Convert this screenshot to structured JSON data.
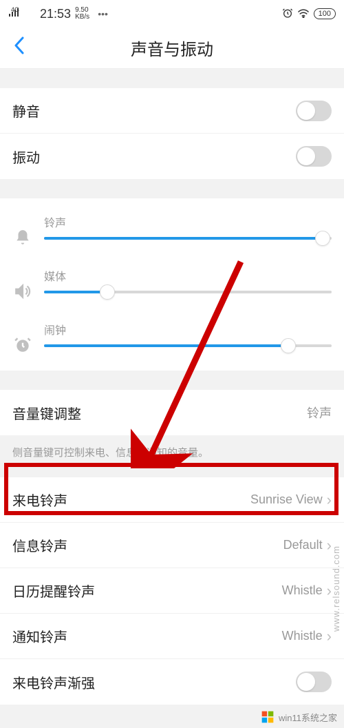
{
  "status": {
    "signal": "4G",
    "time": "21:53",
    "speed_top": "9.50",
    "speed_bottom": "KB/s",
    "dots": "•••",
    "battery": "100"
  },
  "header": {
    "title": "声音与振动"
  },
  "toggles": {
    "silent": "静音",
    "vibrate": "振动"
  },
  "sliders": {
    "ringtone": "铃声",
    "media": "媒体",
    "alarm": "闹钟",
    "ringtone_pct": 97,
    "media_pct": 22,
    "alarm_pct": 85
  },
  "volume_key": {
    "label": "音量键调整",
    "value": "铃声",
    "helper": "侧音量键可控制来电、信息和通知的音量。"
  },
  "ringtones": {
    "call": {
      "label": "来电铃声",
      "value": "Sunrise View"
    },
    "message": {
      "label": "信息铃声",
      "value": "Default"
    },
    "calendar": {
      "label": "日历提醒铃声",
      "value": "Whistle"
    },
    "notification": {
      "label": "通知铃声",
      "value": "Whistle"
    },
    "fade_in": "来电铃声渐强"
  },
  "watermarks": {
    "bottom": "win11系统之家",
    "side": "www.relsound.com"
  }
}
